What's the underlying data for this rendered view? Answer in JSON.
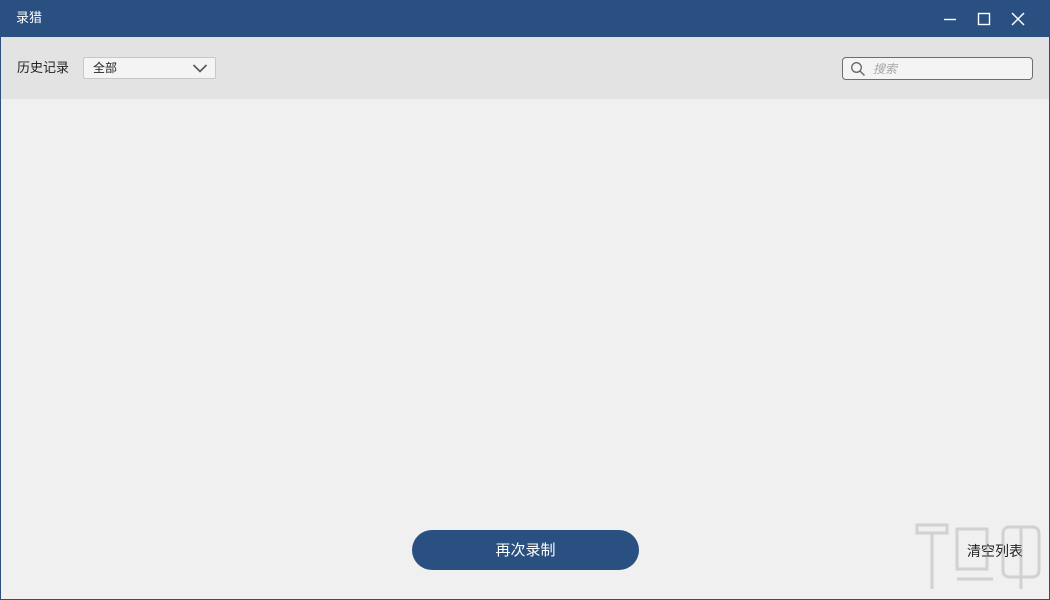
{
  "window": {
    "title": "录猎",
    "controls": {
      "minimize": "minimize-icon",
      "maximize": "maximize-icon",
      "close": "close-icon"
    }
  },
  "toolbar": {
    "history_label": "历史记录",
    "filter": {
      "selected": "全部"
    },
    "search": {
      "placeholder": "搜索",
      "value": ""
    }
  },
  "list": {
    "items": []
  },
  "footer": {
    "record_again_label": "再次录制",
    "clear_list_label": "清空列表"
  },
  "colors": {
    "title_bar": "#2a5081",
    "toolbar_bg": "#e3e3e3",
    "content_bg": "#f0f0f0",
    "primary_button": "#2a5081"
  }
}
